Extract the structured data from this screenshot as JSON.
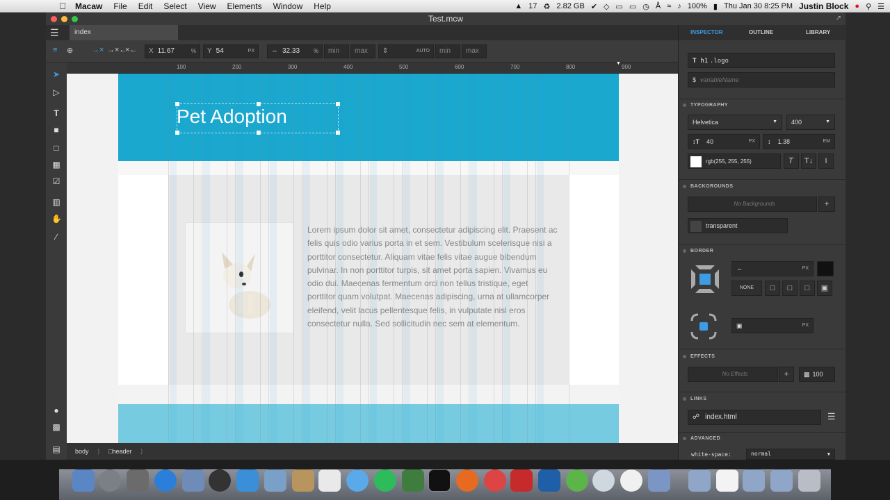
{
  "menubar": {
    "app": "Macaw",
    "items": [
      "File",
      "Edit",
      "Select",
      "View",
      "Elements",
      "Window",
      "Help"
    ],
    "adobe_count": "17",
    "memory": "2.82 GB",
    "battery": "100%",
    "clock": "Thu Jan 30  8:25 PM",
    "user": "Justin Block"
  },
  "window": {
    "title": "Test.mcw"
  },
  "tabs": {
    "active": "index"
  },
  "toolbar": {
    "x_label": "X",
    "x_value": "11.67",
    "x_unit": "%",
    "y_label": "Y",
    "y_value": "54",
    "y_unit": "PX",
    "width_value": "32.33",
    "width_unit": "%",
    "min1": "min",
    "max1": "max",
    "height_value": "AUTO",
    "min2": "min",
    "max2": "max"
  },
  "ruler": [
    "100",
    "200",
    "300",
    "400",
    "500",
    "600",
    "700",
    "800",
    "900"
  ],
  "page": {
    "logo_text": "Pet Adoption",
    "paragraph": "Lorem ipsum dolor sit amet, consectetur adipiscing elit. Praesent ac felis quis odio varius porta in et sem. Vestibulum scelerisque nisi a porttitor consectetur. Aliquam vitae felis vitae augue bibendum pulvinar. In non porttitor turpis, sit amet porta sapien. Vivamus eu odio dui. Maecenas fermentum orci non tellus tristique, eget porttitor quam volutpat. Maecenas adipiscing, urna at ullamcorper eleifend, velit lacus pellentesque felis, in vulputate nisl eros consectetur nulla. Sed sollicitudin nec sem at elementum."
  },
  "breadcrumbs": [
    "body",
    "header"
  ],
  "inspector": {
    "tabs": [
      "INSPECTOR",
      "OUTLINE",
      "LIBRARY"
    ],
    "selector_tag": "h1",
    "selector_class": ".logo",
    "variable_placeholder": "variableName",
    "typography_title": "TYPOGRAPHY",
    "font_family": "Helvetica",
    "font_weight": "400",
    "font_size": "40",
    "font_size_unit": "PX",
    "line_height": "1.38",
    "line_height_unit": "EM",
    "color_text": "rgb(255, 255, 255)",
    "backgrounds_title": "BACKGROUNDS",
    "no_backgrounds": "No Backgrounds",
    "bg_value": "transparent",
    "border_title": "BORDER",
    "border_unit": "PX",
    "border_none": "NONE",
    "radius_unit": "PX",
    "effects_title": "EFFECTS",
    "no_effects": "No Effects",
    "opacity": "100",
    "links_title": "LINKS",
    "link_value": "index.html",
    "advanced_title": "ADVANCED",
    "adv_prop": "white-space:",
    "adv_value": "normal"
  },
  "colors": {
    "header": "#1aa8cf",
    "footer": "#76cbe1",
    "accent": "#3c9ce4"
  }
}
